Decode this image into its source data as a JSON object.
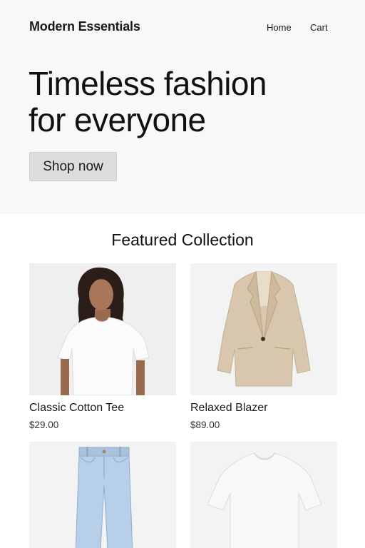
{
  "header": {
    "brand": "Modern Essentials",
    "nav": {
      "home": "Home",
      "cart": "Cart"
    }
  },
  "hero": {
    "headline_line1": "Timeless fashion",
    "headline_line2": "for everyone",
    "cta_label": "Shop now"
  },
  "featured": {
    "title": "Featured Collection",
    "products": [
      {
        "name": "Classic Cotton Tee",
        "price": "$29.00",
        "image": "woman-white-tee-photo"
      },
      {
        "name": "Relaxed Blazer",
        "price": "$89.00",
        "image": "beige-blazer-photo"
      },
      {
        "name": "",
        "price": "",
        "image": "light-wash-jeans-photo"
      },
      {
        "name": "",
        "price": "",
        "image": "white-tee-photo"
      }
    ]
  },
  "colors": {
    "hero_bg": "#f9f8f6",
    "button_bg": "#dcdcdc",
    "text": "#1a1a1a"
  }
}
